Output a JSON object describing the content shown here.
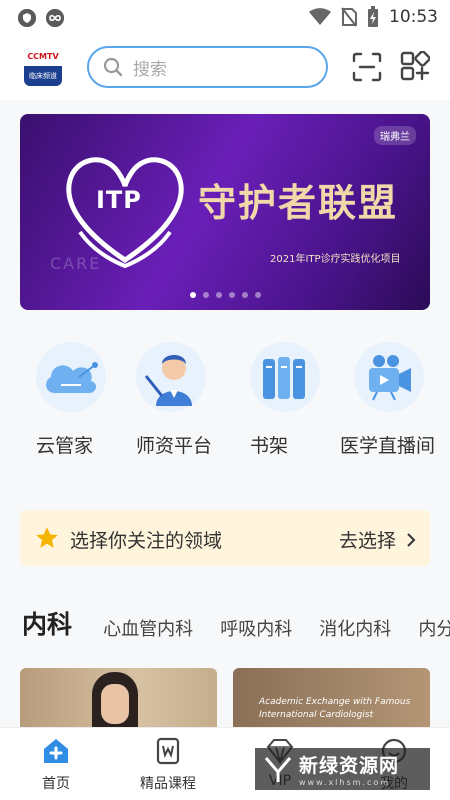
{
  "status_bar": {
    "time": "10:53",
    "icons": [
      "shield-icon",
      "infinity-icon",
      "wifi-icon",
      "no-sim-icon",
      "battery-charging-icon"
    ]
  },
  "header": {
    "logo_text_top": "CCMTV",
    "logo_text_bottom": "临床频道",
    "search_placeholder": "搜索",
    "icons": [
      "scan-icon",
      "qr-code-icon"
    ]
  },
  "banner": {
    "brand": "瑞弗兰",
    "heart_text": "ITP",
    "title": "守护者联盟",
    "subtitle": "2021年ITP诊疗实践优化项目",
    "watermark_text": "CARE",
    "slide_count": 6,
    "active_slide": 0
  },
  "quick_entries": [
    {
      "label": "云管家",
      "icon": "cloud-icon"
    },
    {
      "label": "师资平台",
      "icon": "teacher-icon"
    },
    {
      "label": "书架",
      "icon": "bookshelf-icon"
    },
    {
      "label": "医学直播间",
      "icon": "video-camera-icon"
    }
  ],
  "focus": {
    "message": "选择你关注的领域",
    "action": "去选择",
    "icons": [
      "star-icon",
      "chevron-right-icon"
    ]
  },
  "departments": {
    "active": "内科",
    "items": [
      "心血管内科",
      "呼吸内科",
      "消化内科",
      "内分"
    ]
  },
  "cards": [
    {
      "caption": ""
    },
    {
      "caption": "Academic Exchange with Famous International Cardiologist"
    }
  ],
  "tab_bar": {
    "items": [
      {
        "label": "首页",
        "icon": "home-icon",
        "active": true
      },
      {
        "label": "精品课程",
        "icon": "course-icon",
        "active": false
      },
      {
        "label": "VIP",
        "icon": "vip-diamond-icon",
        "active": false
      },
      {
        "label": "我的",
        "icon": "profile-icon",
        "active": false
      }
    ]
  },
  "watermark": {
    "main": "新绿资源网",
    "sub": "www.xlhsm.com"
  },
  "colors": {
    "accent": "#2f8de4",
    "search_border": "#5aa6ea",
    "focus_bg": "#fff5dd",
    "star": "#f5b400"
  }
}
